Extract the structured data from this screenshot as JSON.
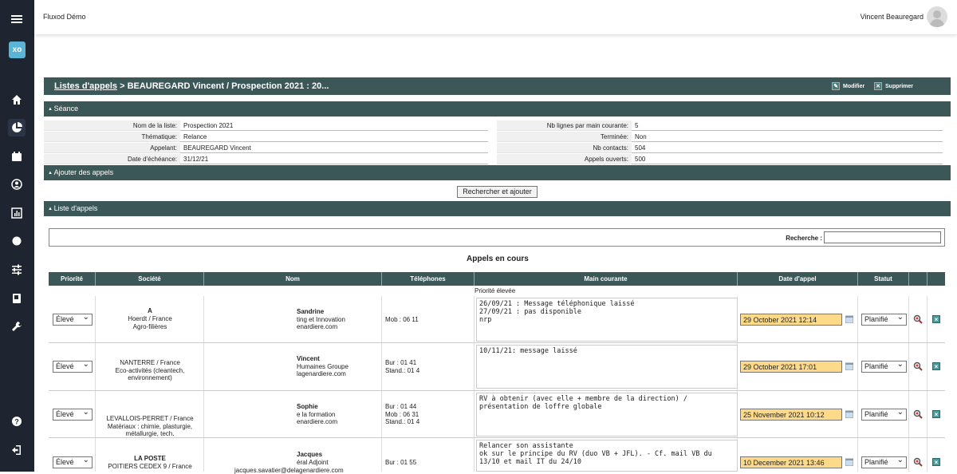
{
  "app": {
    "brand": "Fluxod Démo",
    "user": "Vincent Beauregard",
    "logo": "xo"
  },
  "nav_icons": [
    "menu-icon",
    "home-icon",
    "pie-chart-icon",
    "calendar-icon",
    "contact-icon",
    "bar-chart-icon",
    "gear-icon",
    "sliders-icon",
    "book-icon",
    "wrench-icon",
    "help-icon",
    "logout-icon"
  ],
  "title": {
    "link": "Listes d'appels",
    "rest": " > BEAUREGARD Vincent / Prospection 2021 : 20...",
    "modify": "Modifier",
    "delete": "Supprimer"
  },
  "sections": {
    "seance": "Séance",
    "ajouter": "Ajouter des appels",
    "liste": "Liste d'appels"
  },
  "info_left": [
    {
      "label": "Nom de la liste:",
      "value": "Prospection 2021"
    },
    {
      "label": "Thématique:",
      "value": "Relance"
    },
    {
      "label": "Appelant:",
      "value": "BEAUREGARD Vincent"
    },
    {
      "label": "Date d'échéance:",
      "value": "31/12/21"
    }
  ],
  "info_right": [
    {
      "label": "Nb lignes par main courante:",
      "value": "5"
    },
    {
      "label": "Terminée:",
      "value": "Non"
    },
    {
      "label": "Nb contacts:",
      "value": "504"
    },
    {
      "label": "Appels ouverts:",
      "value": "500"
    }
  ],
  "search_button": "Rechercher et ajouter",
  "recherche_label": "Recherche :",
  "appels_title": "Appels en cours",
  "columns": [
    "Priorité",
    "Société",
    "Nom",
    "Téléphones",
    "Main courante",
    "Date d'appel",
    "Statut"
  ],
  "priority_group": "Priorité élevée",
  "rows": [
    {
      "priority": "Élevé",
      "soc": [
        "A",
        "Hoerdt / France",
        "Agro-filières"
      ],
      "nom": [
        "Sandrine",
        "ting et Innovation",
        "enardiere.com"
      ],
      "tel": [
        "Mob : 06 11"
      ],
      "main": "26/09/21 : Message téléphonique laissé\n27/09/21 : pas disponible\nnrp",
      "date": "29 October 2021 12:14",
      "statut": "Planifié"
    },
    {
      "priority": "Élevé",
      "soc": [
        "NANTERRE / France",
        "Eco-activités (cleantech,",
        "environnement)"
      ],
      "nom": [
        "Vincent",
        "Humaines Groupe",
        "lagenardiere.com"
      ],
      "tel": [
        "Bur : 01 41",
        "Stand.: 01 4"
      ],
      "main": "10/11/21: message laissé",
      "date": "29 October 2021 17:01",
      "statut": "Planifié"
    },
    {
      "priority": "Élevé",
      "soc": [
        "LEVALLOIS-PERRET / France",
        "Matériaux : chimie, plasturgie,",
        "métallurgie, tech."
      ],
      "nom": [
        "Sophie",
        "e la formation",
        "enardiere.com"
      ],
      "tel": [
        "Bur : 01 44",
        "Mob : 06 31",
        "Stand.: 01 4"
      ],
      "main": "RV à obtenir (avec elle + membre de la direction) / présentation de loffre globale",
      "date": "25 November 2021 10:12",
      "statut": "Planifié"
    },
    {
      "priority": "Élevé",
      "soc": [
        "LA POSTE",
        "POITIERS CEDEX 9 / France"
      ],
      "nom": [
        "Jacques",
        "éral Adjoint",
        "jacques.savatier@delagenardiere.com"
      ],
      "tel": [
        "Bur : 01 55"
      ],
      "main": "Relancer son assistante\nok sur le principe du RV (duo VB + JFL). - Cf. mail VB du 13/10 et mail IT du 24/10",
      "date": "10 December 2021 13:46",
      "statut": "Planifié"
    }
  ]
}
